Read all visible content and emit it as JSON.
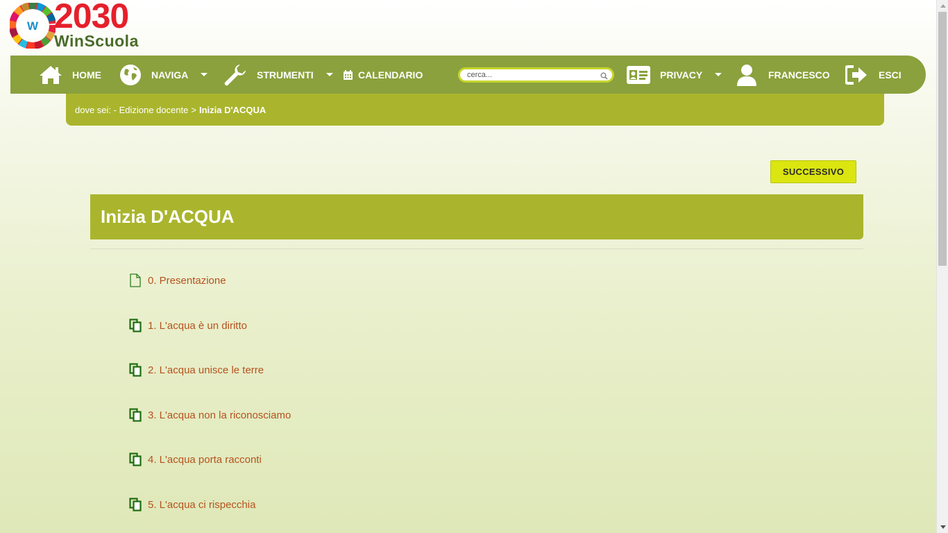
{
  "logo": {
    "number": "2030",
    "subtitle": "WinScuola",
    "badge_letter": "W"
  },
  "nav": {
    "home": "HOME",
    "naviga": "NAVIGA",
    "strumenti": "STRUMENTI",
    "calendario": "CALENDARIO",
    "search_placeholder": "cerca...",
    "privacy": "PRIVACY",
    "user": "FRANCESCO",
    "esci": "ESCI"
  },
  "breadcrumb": {
    "prefix": "dove sei: -",
    "item1": "Edizione docente",
    "separator": ">",
    "current": "Inizia D'ACQUA"
  },
  "next_button": "SUCCESSIVO",
  "page_title": "Inizia D'ACQUA",
  "chapters": [
    {
      "label": "0. Presentazione",
      "icon": "page-icon"
    },
    {
      "label": "1. L'acqua è un diritto",
      "icon": "pages-icon"
    },
    {
      "label": "2. L'acqua unisce le terre",
      "icon": "pages-icon"
    },
    {
      "label": "3. L'acqua non la riconosciamo",
      "icon": "pages-icon"
    },
    {
      "label": "4. L'acqua porta racconti",
      "icon": "pages-icon"
    },
    {
      "label": "5. L'acqua ci rispecchia",
      "icon": "pages-icon"
    }
  ],
  "colors": {
    "navbar": "#8aa13d",
    "accent": "#aab52d",
    "button": "#dbe50f",
    "link": "#b5521e",
    "icon_green": "#2e7d1f"
  }
}
